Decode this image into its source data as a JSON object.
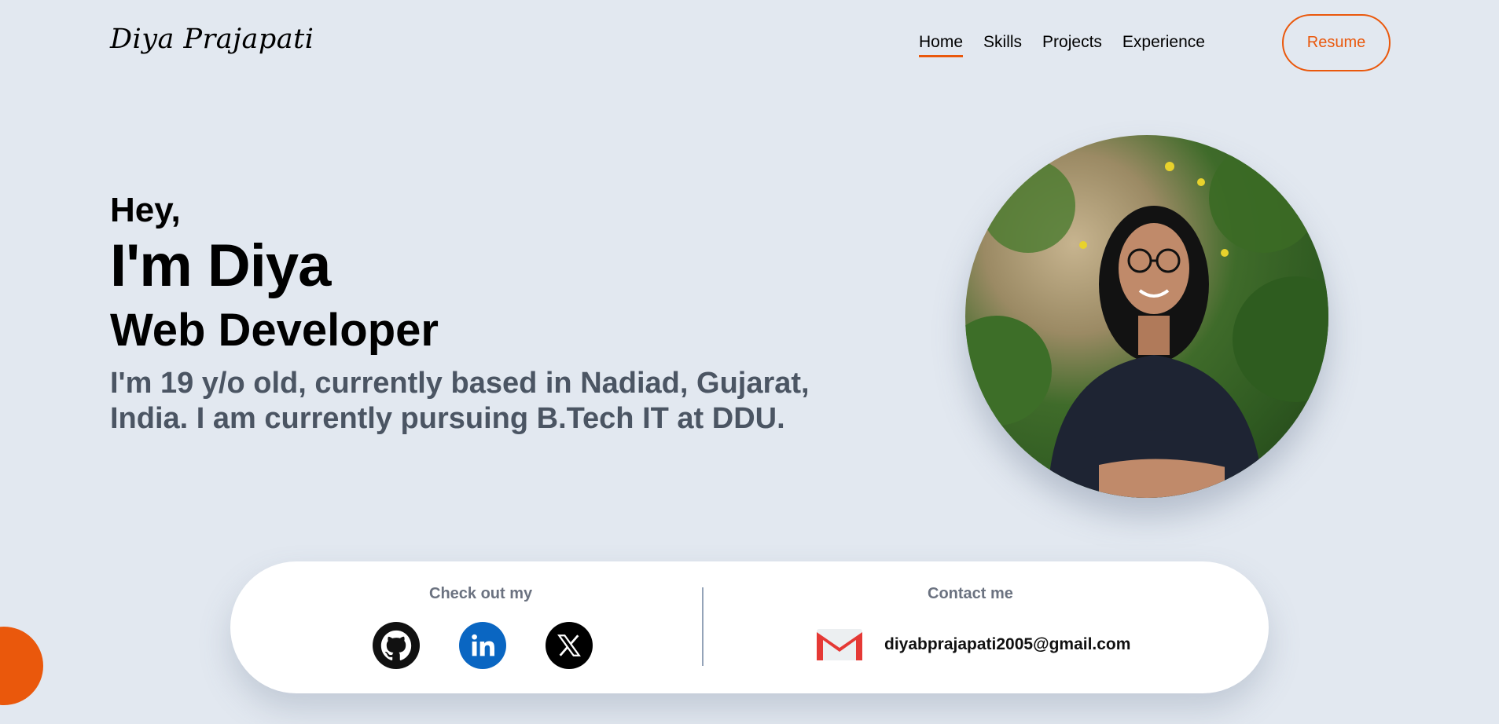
{
  "brand": {
    "logo": "Diya Prajapati"
  },
  "nav": {
    "items": [
      "Home",
      "Skills",
      "Projects",
      "Experience"
    ],
    "active": "Home",
    "resume_label": "Resume"
  },
  "hero": {
    "greeting": "Hey,",
    "name": "I'm Diya",
    "role": "Web Developer",
    "bio_line1": "I'm 19 y/o old, currently based in Nadiad, Gujarat,",
    "bio_line2": "India. I am currently pursuing B.Tech IT at DDU."
  },
  "contact_card": {
    "social_heading": "Check out my",
    "social_icons": [
      "github-icon",
      "linkedin-icon",
      "x-icon"
    ],
    "contact_heading": "Contact me",
    "email_icon": "gmail-icon",
    "email": "diyabprajapati2005@gmail.com"
  },
  "colors": {
    "background": "#e2e8f0",
    "accent": "#ea580c",
    "muted_text": "#4b5563",
    "card": "#ffffff",
    "linkedin": "#0a66c2"
  }
}
